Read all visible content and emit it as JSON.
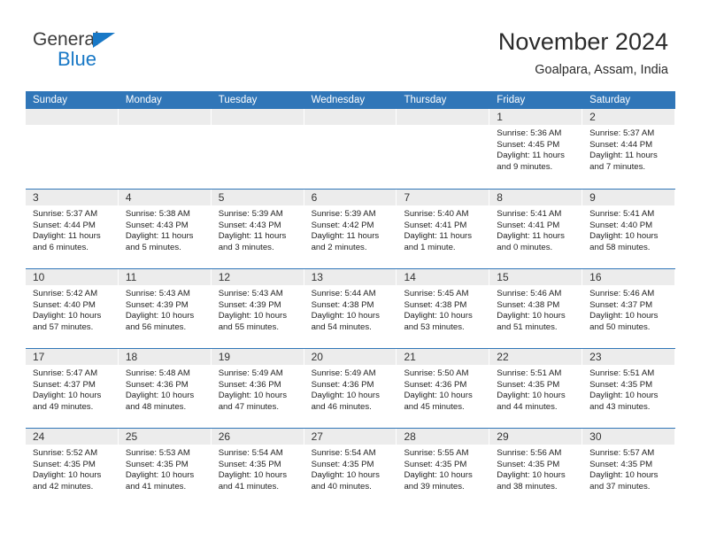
{
  "brand": {
    "name_part1": "General",
    "name_part2": "Blue",
    "colors": {
      "blue": "#1878c6",
      "header_blue": "#3076b8",
      "date_band": "#ececec"
    }
  },
  "header": {
    "month_title": "November 2024",
    "location": "Goalpara, Assam, India"
  },
  "calendar": {
    "weekday_headers": [
      "Sunday",
      "Monday",
      "Tuesday",
      "Wednesday",
      "Thursday",
      "Friday",
      "Saturday"
    ],
    "weeks": [
      [
        {
          "date": "",
          "lines": []
        },
        {
          "date": "",
          "lines": []
        },
        {
          "date": "",
          "lines": []
        },
        {
          "date": "",
          "lines": []
        },
        {
          "date": "",
          "lines": []
        },
        {
          "date": "1",
          "lines": [
            "Sunrise: 5:36 AM",
            "Sunset: 4:45 PM",
            "Daylight: 11 hours",
            "and 9 minutes."
          ]
        },
        {
          "date": "2",
          "lines": [
            "Sunrise: 5:37 AM",
            "Sunset: 4:44 PM",
            "Daylight: 11 hours",
            "and 7 minutes."
          ]
        }
      ],
      [
        {
          "date": "3",
          "lines": [
            "Sunrise: 5:37 AM",
            "Sunset: 4:44 PM",
            "Daylight: 11 hours",
            "and 6 minutes."
          ]
        },
        {
          "date": "4",
          "lines": [
            "Sunrise: 5:38 AM",
            "Sunset: 4:43 PM",
            "Daylight: 11 hours",
            "and 5 minutes."
          ]
        },
        {
          "date": "5",
          "lines": [
            "Sunrise: 5:39 AM",
            "Sunset: 4:43 PM",
            "Daylight: 11 hours",
            "and 3 minutes."
          ]
        },
        {
          "date": "6",
          "lines": [
            "Sunrise: 5:39 AM",
            "Sunset: 4:42 PM",
            "Daylight: 11 hours",
            "and 2 minutes."
          ]
        },
        {
          "date": "7",
          "lines": [
            "Sunrise: 5:40 AM",
            "Sunset: 4:41 PM",
            "Daylight: 11 hours",
            "and 1 minute."
          ]
        },
        {
          "date": "8",
          "lines": [
            "Sunrise: 5:41 AM",
            "Sunset: 4:41 PM",
            "Daylight: 11 hours",
            "and 0 minutes."
          ]
        },
        {
          "date": "9",
          "lines": [
            "Sunrise: 5:41 AM",
            "Sunset: 4:40 PM",
            "Daylight: 10 hours",
            "and 58 minutes."
          ]
        }
      ],
      [
        {
          "date": "10",
          "lines": [
            "Sunrise: 5:42 AM",
            "Sunset: 4:40 PM",
            "Daylight: 10 hours",
            "and 57 minutes."
          ]
        },
        {
          "date": "11",
          "lines": [
            "Sunrise: 5:43 AM",
            "Sunset: 4:39 PM",
            "Daylight: 10 hours",
            "and 56 minutes."
          ]
        },
        {
          "date": "12",
          "lines": [
            "Sunrise: 5:43 AM",
            "Sunset: 4:39 PM",
            "Daylight: 10 hours",
            "and 55 minutes."
          ]
        },
        {
          "date": "13",
          "lines": [
            "Sunrise: 5:44 AM",
            "Sunset: 4:38 PM",
            "Daylight: 10 hours",
            "and 54 minutes."
          ]
        },
        {
          "date": "14",
          "lines": [
            "Sunrise: 5:45 AM",
            "Sunset: 4:38 PM",
            "Daylight: 10 hours",
            "and 53 minutes."
          ]
        },
        {
          "date": "15",
          "lines": [
            "Sunrise: 5:46 AM",
            "Sunset: 4:38 PM",
            "Daylight: 10 hours",
            "and 51 minutes."
          ]
        },
        {
          "date": "16",
          "lines": [
            "Sunrise: 5:46 AM",
            "Sunset: 4:37 PM",
            "Daylight: 10 hours",
            "and 50 minutes."
          ]
        }
      ],
      [
        {
          "date": "17",
          "lines": [
            "Sunrise: 5:47 AM",
            "Sunset: 4:37 PM",
            "Daylight: 10 hours",
            "and 49 minutes."
          ]
        },
        {
          "date": "18",
          "lines": [
            "Sunrise: 5:48 AM",
            "Sunset: 4:36 PM",
            "Daylight: 10 hours",
            "and 48 minutes."
          ]
        },
        {
          "date": "19",
          "lines": [
            "Sunrise: 5:49 AM",
            "Sunset: 4:36 PM",
            "Daylight: 10 hours",
            "and 47 minutes."
          ]
        },
        {
          "date": "20",
          "lines": [
            "Sunrise: 5:49 AM",
            "Sunset: 4:36 PM",
            "Daylight: 10 hours",
            "and 46 minutes."
          ]
        },
        {
          "date": "21",
          "lines": [
            "Sunrise: 5:50 AM",
            "Sunset: 4:36 PM",
            "Daylight: 10 hours",
            "and 45 minutes."
          ]
        },
        {
          "date": "22",
          "lines": [
            "Sunrise: 5:51 AM",
            "Sunset: 4:35 PM",
            "Daylight: 10 hours",
            "and 44 minutes."
          ]
        },
        {
          "date": "23",
          "lines": [
            "Sunrise: 5:51 AM",
            "Sunset: 4:35 PM",
            "Daylight: 10 hours",
            "and 43 minutes."
          ]
        }
      ],
      [
        {
          "date": "24",
          "lines": [
            "Sunrise: 5:52 AM",
            "Sunset: 4:35 PM",
            "Daylight: 10 hours",
            "and 42 minutes."
          ]
        },
        {
          "date": "25",
          "lines": [
            "Sunrise: 5:53 AM",
            "Sunset: 4:35 PM",
            "Daylight: 10 hours",
            "and 41 minutes."
          ]
        },
        {
          "date": "26",
          "lines": [
            "Sunrise: 5:54 AM",
            "Sunset: 4:35 PM",
            "Daylight: 10 hours",
            "and 41 minutes."
          ]
        },
        {
          "date": "27",
          "lines": [
            "Sunrise: 5:54 AM",
            "Sunset: 4:35 PM",
            "Daylight: 10 hours",
            "and 40 minutes."
          ]
        },
        {
          "date": "28",
          "lines": [
            "Sunrise: 5:55 AM",
            "Sunset: 4:35 PM",
            "Daylight: 10 hours",
            "and 39 minutes."
          ]
        },
        {
          "date": "29",
          "lines": [
            "Sunrise: 5:56 AM",
            "Sunset: 4:35 PM",
            "Daylight: 10 hours",
            "and 38 minutes."
          ]
        },
        {
          "date": "30",
          "lines": [
            "Sunrise: 5:57 AM",
            "Sunset: 4:35 PM",
            "Daylight: 10 hours",
            "and 37 minutes."
          ]
        }
      ]
    ]
  }
}
